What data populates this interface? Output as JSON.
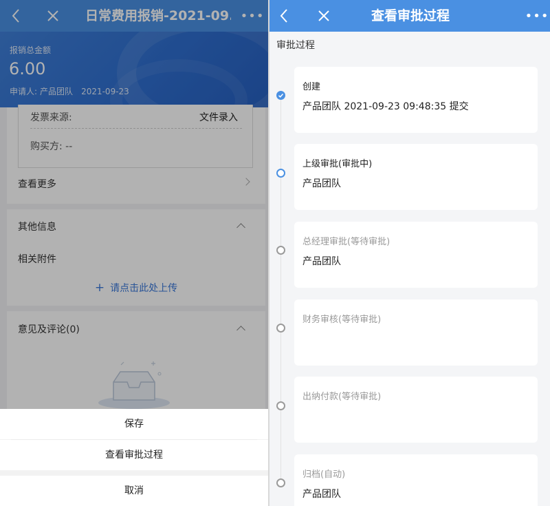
{
  "left": {
    "navbar": {
      "title": "日常费用报销-2021-09...",
      "more": "•••"
    },
    "hero": {
      "label": "报销总金额",
      "amount": "6.00",
      "applicant_label": "申请人:",
      "applicant": "产品团队",
      "date": "2021-09-23"
    },
    "invoice": {
      "source_label": "发票来源:",
      "source_value": "文件录入",
      "buyer": "购买方: --"
    },
    "see_more": "查看更多",
    "other_info": {
      "title": "其他信息",
      "attachments": "相关附件",
      "upload": "请点击此处上传"
    },
    "comments": {
      "title": "意见及评论(0)"
    },
    "sheet": {
      "save": "保存",
      "view_process": "查看审批过程",
      "cancel": "取消"
    }
  },
  "right": {
    "navbar": {
      "title": "查看审批过程",
      "more": "•••"
    },
    "section_title": "审批过程",
    "steps": [
      {
        "name": "创建",
        "detail": "产品团队  2021-09-23 09:48:35 提交",
        "status": "done"
      },
      {
        "name": "上级审批(审批中)",
        "detail": "产品团队",
        "status": "active"
      },
      {
        "name": "总经理审批(等待审批)",
        "detail": "产品团队",
        "status": "pending"
      },
      {
        "name": "财务审核(等待审批)",
        "detail": "",
        "status": "pending"
      },
      {
        "name": "出纳付款(等待审批)",
        "detail": "",
        "status": "pending"
      },
      {
        "name": "归档(自动)",
        "detail": "产品团队",
        "status": "pending"
      }
    ]
  },
  "colors": {
    "nav_blue": "#4a90e2",
    "hero_blue": "#2f6ecf",
    "link_blue": "#3a78d8",
    "done_blue": "#4a90e2"
  }
}
